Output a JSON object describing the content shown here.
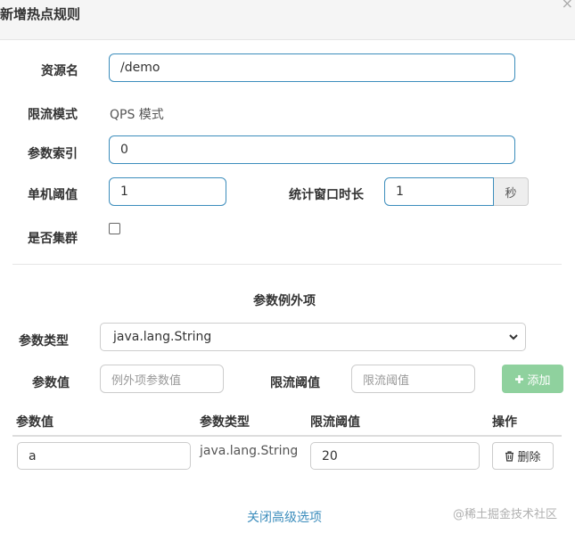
{
  "dialog": {
    "title": "新增热点规则",
    "close_icon": "×"
  },
  "form": {
    "resource_label": "资源名",
    "resource_value": "/demo",
    "mode_label": "限流模式",
    "mode_value": "QPS 模式",
    "param_index_label": "参数索引",
    "param_index_value": "0",
    "threshold_label": "单机阈值",
    "threshold_value": "1",
    "window_label": "统计窗口时长",
    "window_value": "1",
    "window_unit": "秒",
    "cluster_label": "是否集群",
    "cluster_checked": false
  },
  "exceptions": {
    "title": "参数例外项",
    "type_label": "参数类型",
    "type_selected": "java.lang.String",
    "value_label": "参数值",
    "value_placeholder": "例外项参数值",
    "limit_label": "限流阈值",
    "limit_placeholder": "限流阈值",
    "add_button": "添加",
    "table": {
      "headers": [
        "参数值",
        "参数类型",
        "限流阈值",
        "操作"
      ],
      "rows": [
        {
          "value": "a",
          "type": "java.lang.String",
          "limit": "20",
          "action": "删除"
        }
      ]
    }
  },
  "footer": {
    "toggle_link": "关闭高级选项",
    "watermark": "@稀土掘金技术社区"
  }
}
